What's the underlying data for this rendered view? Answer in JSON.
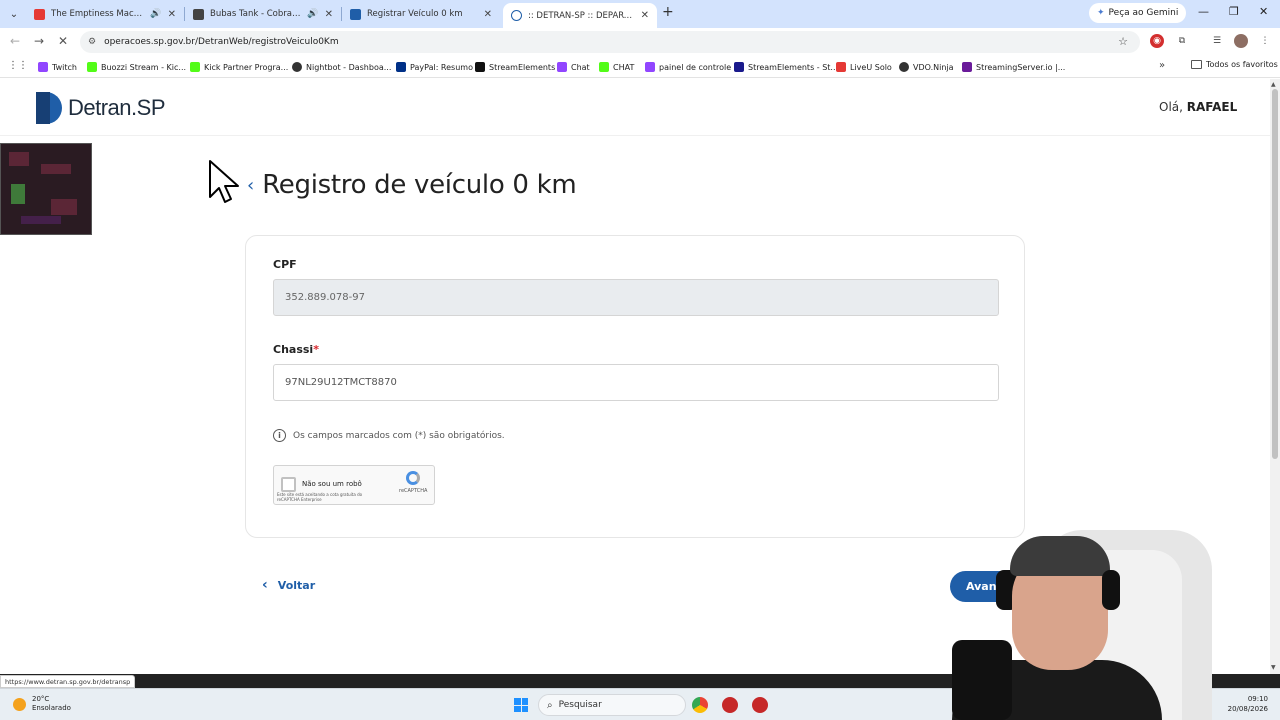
{
  "browser": {
    "tabs": [
      {
        "title": "The Emptiness Machine (Of",
        "favicon_color": "#e53935",
        "audio": true
      },
      {
        "title": "Bubas Tank - Cobras — Bai",
        "favicon_color": "#444444",
        "audio": true
      },
      {
        "title": "Registrar Veículo 0 km",
        "favicon_color": "#1f5ea8",
        "audio": false
      },
      {
        "title": ":: DETRAN-SP :: DEPARTAMENT",
        "favicon_color": "#1f5ea8",
        "audio": false,
        "active": true
      }
    ],
    "gemini_label": "Peça ao Gemini",
    "url": "operacoes.sp.gov.br/DetranWeb/registroVeiculo0Km",
    "bookmarks": [
      {
        "label": "Twitch",
        "color": "#9146ff"
      },
      {
        "label": "Buozzi Stream - Kic...",
        "color": "#53fc18"
      },
      {
        "label": "Kick Partner Progra...",
        "color": "#53fc18"
      },
      {
        "label": "Nightbot - Dashboa...",
        "color": "#333333"
      },
      {
        "label": "PayPal: Resumo",
        "color": "#003087"
      },
      {
        "label": "StreamElements",
        "color": "#111111"
      },
      {
        "label": "Chat",
        "color": "#9146ff"
      },
      {
        "label": "CHAT",
        "color": "#53fc18"
      },
      {
        "label": "painel de controle",
        "color": "#9146ff"
      },
      {
        "label": "StreamElements - St...",
        "color": "#1a1a8c"
      },
      {
        "label": "LiveU Solo",
        "color": "#e53935"
      },
      {
        "label": "VDO.Ninja",
        "color": "#333333"
      },
      {
        "label": "StreamingServer.io |...",
        "color": "#6a1b9a"
      }
    ],
    "all_bookmarks": "Todos os favoritos",
    "status_url": "https://www.detran.sp.gov.br/detransp"
  },
  "header": {
    "logo_text": "Detran.SP",
    "greeting_prefix": "Olá,",
    "user_name": "RAFAEL"
  },
  "main": {
    "title": "Registro de veículo 0 km",
    "cpf_label": "CPF",
    "cpf_value": "352.889.078-97",
    "chassi_label": "Chassi",
    "chassi_required": "*",
    "chassi_value": "97NL29U12TMCT8870",
    "hint": "Os campos marcados com (*) são obrigatórios.",
    "recaptcha_label": "Não sou um robô",
    "recaptcha_brand": "reCAPTCHA",
    "recaptcha_terms": "Este site está aceitando a cota gratuita do reCAPTCHA Enterprise",
    "back_label": "Voltar",
    "next_label": "Avanç"
  },
  "taskbar": {
    "temperature": "20°C",
    "weather": "Ensolarado",
    "search_placeholder": "Pesquisar",
    "time": "09:10",
    "date": "20/08/2026"
  },
  "colors": {
    "brand_blue": "#1f5ea8",
    "required_red": "#d9262b"
  }
}
